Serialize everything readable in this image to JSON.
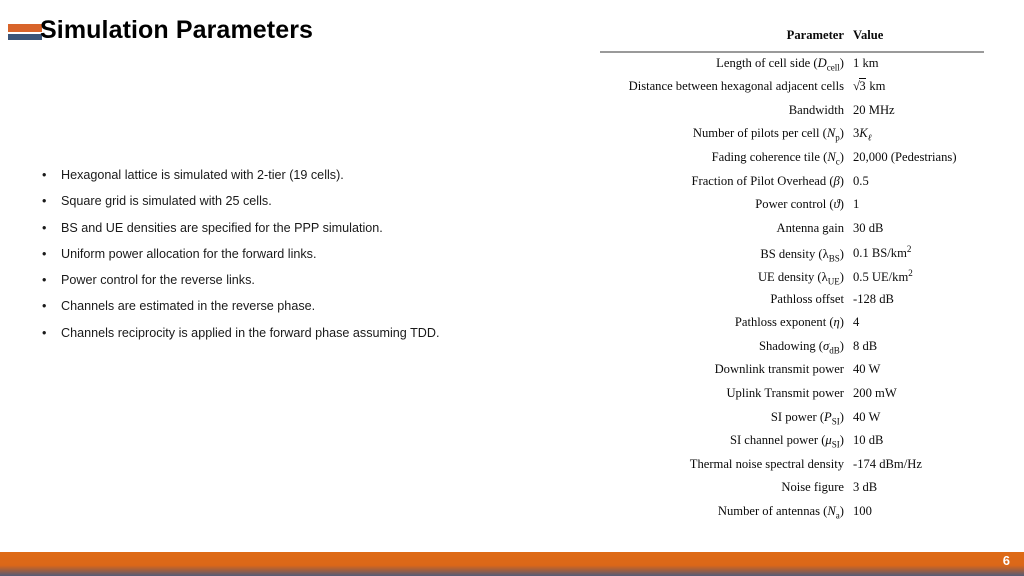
{
  "slide": {
    "title": "Simulation Parameters",
    "page_number": "6",
    "accent_orange": "#D8642A",
    "accent_blue": "#3A5579",
    "footer_orange": "#DE6B16",
    "footer_blue": "#545C78"
  },
  "bullets": [
    "Hexagonal lattice is simulated with 2-tier (19 cells).",
    "Square grid is simulated with 25 cells.",
    "BS and UE densities are specified for the PPP simulation.",
    "Uniform power allocation for the forward links.",
    "Power control for the reverse links.",
    "Channels are estimated in the reverse phase.",
    "Channels reciprocity is applied in the forward phase assuming TDD."
  ],
  "table": {
    "headers": [
      "Parameter",
      "Value"
    ],
    "rows": [
      {
        "parameter": "Length of cell side (Dcell)",
        "value": "1 km"
      },
      {
        "parameter": "Distance between hexagonal adjacent cells",
        "value": "√3 km"
      },
      {
        "parameter": "Bandwidth",
        "value": "20 MHz"
      },
      {
        "parameter": "Number of pilots per cell (Np)",
        "value": "3Kℓ"
      },
      {
        "parameter": "Fading coherence tile (Nc)",
        "value": "20,000 (Pedestrians)"
      },
      {
        "parameter": "Fraction of Pilot Overhead (β)",
        "value": "0.5"
      },
      {
        "parameter": "Power control (ϑ)",
        "value": "1"
      },
      {
        "parameter": "Antenna gain",
        "value": "30 dB"
      },
      {
        "parameter": "BS density (λBS)",
        "value": "0.1 BS/km2"
      },
      {
        "parameter": "UE density (λUE)",
        "value": "0.5 UE/km2"
      },
      {
        "parameter": "Pathloss offset",
        "value": "-128 dB"
      },
      {
        "parameter": "Pathloss exponent (η)",
        "value": "4"
      },
      {
        "parameter": "Shadowing (σdB)",
        "value": "8 dB"
      },
      {
        "parameter": "Downlink transmit power",
        "value": "40 W"
      },
      {
        "parameter": "Uplink Transmit power",
        "value": "200 mW"
      },
      {
        "parameter": "SI power (PSI)",
        "value": "40 W"
      },
      {
        "parameter": "SI channel power (μSI)",
        "value": "10 dB"
      },
      {
        "parameter": "Thermal noise spectral density",
        "value": "-174 dBm/Hz"
      },
      {
        "parameter": "Noise figure",
        "value": "3 dB"
      },
      {
        "parameter": "Number of antennas (Na)",
        "value": "100"
      }
    ]
  }
}
